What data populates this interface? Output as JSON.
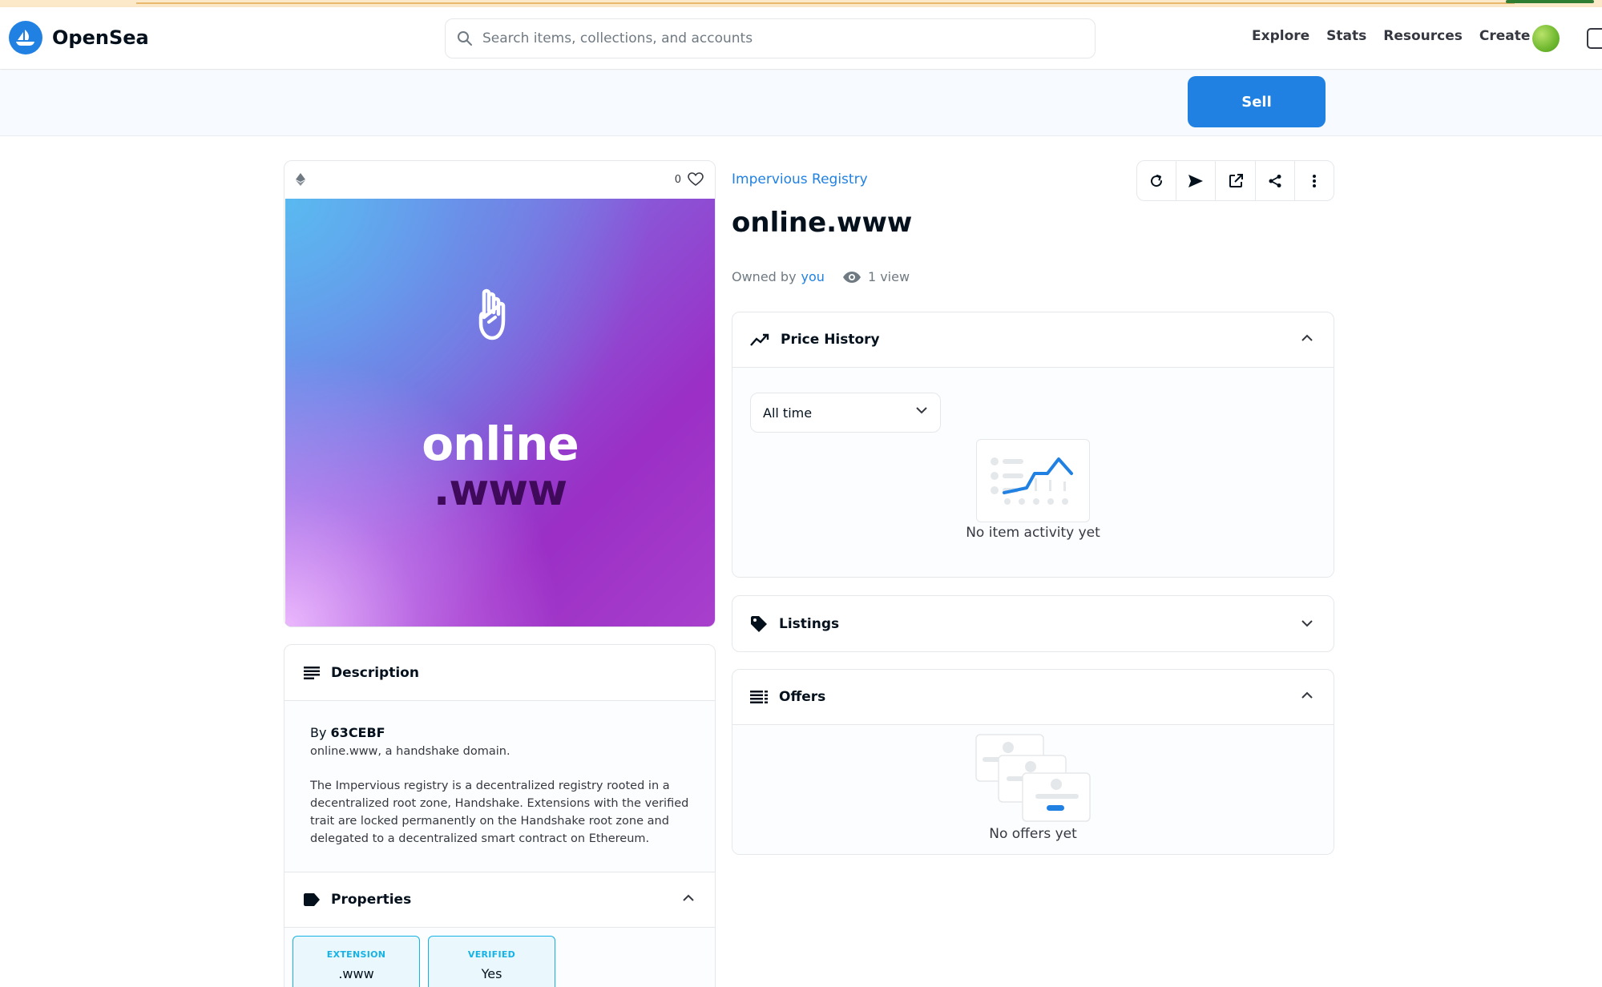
{
  "header": {
    "brand": "OpenSea",
    "search_placeholder": "Search items, collections, and accounts",
    "nav": [
      "Explore",
      "Stats",
      "Resources",
      "Create"
    ]
  },
  "actions": {
    "sell_label": "Sell"
  },
  "item": {
    "like_count": "0",
    "art_title_line1": "online",
    "art_title_line2": ".www",
    "collection": "Impervious Registry",
    "title": "online.www",
    "owned_prefix": "Owned by",
    "owner": "you",
    "views": "1 view"
  },
  "description": {
    "heading": "Description",
    "by_prefix": "By",
    "creator": "63CEBF",
    "summary": "online.www, a handshake domain.",
    "body": "The Impervious registry is a decentralized registry rooted in a decentralized root zone, Handshake. Extensions with the verified trait are locked permanently on the Handshake root zone and delegated to a decentralized smart contract on Ethereum."
  },
  "properties": {
    "heading": "Properties",
    "items": [
      {
        "type": "EXTENSION",
        "value": ".www"
      },
      {
        "type": "VERIFIED",
        "value": "Yes"
      }
    ]
  },
  "price_history": {
    "heading": "Price History",
    "range": "All time",
    "empty": "No item activity yet"
  },
  "listings": {
    "heading": "Listings"
  },
  "offers": {
    "heading": "Offers",
    "empty": "No offers yet"
  },
  "colors": {
    "accent": "#2081e2",
    "text": "#04111d",
    "border": "#e5e8eb",
    "trait": "#15b2e5"
  }
}
